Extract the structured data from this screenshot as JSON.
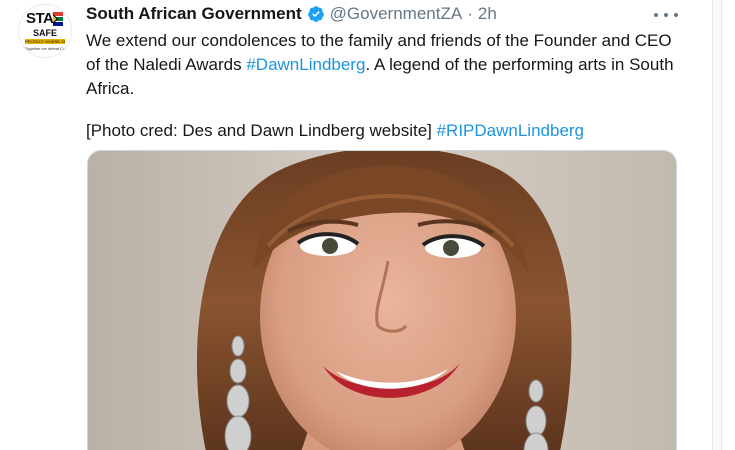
{
  "tweet": {
    "author": {
      "display_name": "South African Government",
      "handle": "@GovernmentZA",
      "verified": true,
      "verified_icon": "verified-badge-icon",
      "avatar": {
        "logo_text": "STAY",
        "logo_sub": "SAFE",
        "logo_banner": "PROTECT WHERE SHOULD",
        "logo_tagline": "Together we defeat Covid-19"
      }
    },
    "separator": "·",
    "time": "2h",
    "more_icon": "more-options-icon",
    "text": {
      "line1_part1": "We extend our condolences to the family and friends of the Founder and CEO of the Naledi Awards ",
      "hashtag1": "#DawnLindberg",
      "line1_part2": ". A legend of the performing arts in South Africa.",
      "line2_part1": "[Photo cred: Des and Dawn Lindberg website] ",
      "hashtag2": "#RIPDawnLindberg"
    },
    "colors": {
      "link": "#1b95e0",
      "text": "#14171a",
      "muted": "#657786",
      "verified": "#1da1f2"
    },
    "media": {
      "type": "photo",
      "subject": "portrait photo"
    }
  }
}
